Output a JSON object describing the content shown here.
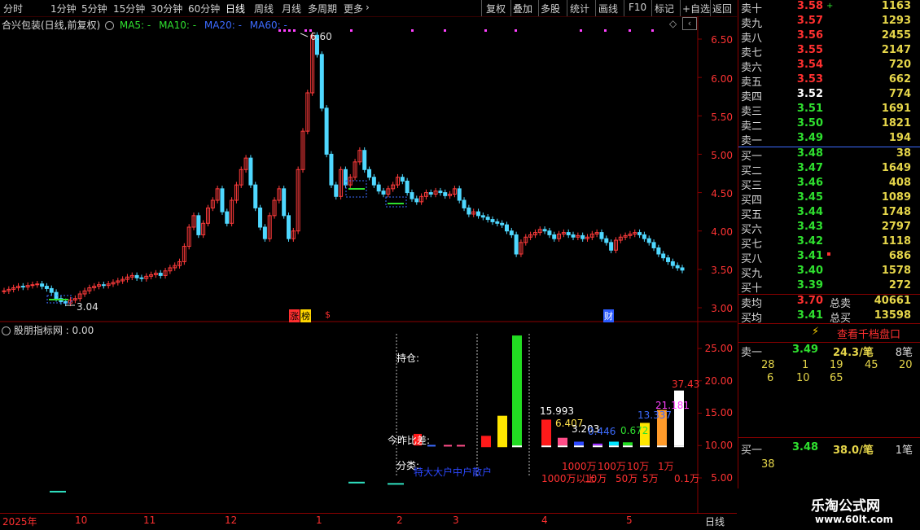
{
  "toolbar": {
    "tabs": [
      "分时",
      "1分钟",
      "5分钟",
      "15分钟",
      "30分钟",
      "60分钟",
      "日线",
      "周线",
      "月线",
      "多周期",
      "更多"
    ],
    "active_tab": "日线",
    "buttons": [
      "复权",
      "叠加",
      "多股",
      "统计",
      "画线",
      "F10",
      "标记",
      "+自选",
      "返回"
    ]
  },
  "chart": {
    "stock_title": "合兴包装(日线,前复权)",
    "ma_labels": [
      {
        "text": "MA5: -",
        "color": "#2fe02f"
      },
      {
        "text": "MA10: -",
        "color": "#2fe02f"
      },
      {
        "text": "MA20: -",
        "color": "#3c6bff"
      },
      {
        "text": "MA60: -",
        "color": "#3c6bff"
      }
    ],
    "high_label": "6.60",
    "low_label": "3.04",
    "y_axis": [
      "6.50",
      "6.00",
      "5.50",
      "5.00",
      "4.50",
      "4.00",
      "3.50",
      "3.00"
    ],
    "event_labels": [
      "涨",
      "榜",
      "$",
      "财"
    ]
  },
  "indicator": {
    "title": "股朋指标网 : 0.00",
    "y_axis": [
      "25.00",
      "20.00",
      "15.00",
      "10.00",
      "5.00"
    ],
    "label_hold": "持仓:",
    "label_diff": "今昨比差:",
    "label_class": "分类:",
    "class_text": "特大大户中户散户",
    "bar_values": [
      "15.993",
      "6.407",
      "3.203",
      "0.446",
      "0.672",
      "13.337",
      "21.181",
      "37.43"
    ],
    "tier_row1": [
      "1000万",
      "100万",
      "10万",
      "1万"
    ],
    "tier_row2": [
      "1000万以上",
      "10万",
      "50万",
      "5万",
      "0.1万"
    ]
  },
  "x_axis": [
    "2025年",
    "10",
    "11",
    "12",
    "1",
    "2",
    "3",
    "4",
    "5"
  ],
  "x_period": "日线",
  "order_book": {
    "asks": [
      {
        "label": "卖十",
        "price": "3.58",
        "vol": "1163",
        "color": "#ff3030"
      },
      {
        "label": "卖九",
        "price": "3.57",
        "vol": "1293",
        "color": "#ff3030"
      },
      {
        "label": "卖八",
        "price": "3.56",
        "vol": "2455",
        "color": "#ff3030"
      },
      {
        "label": "卖七",
        "price": "3.55",
        "vol": "2147",
        "color": "#ff3030"
      },
      {
        "label": "卖六",
        "price": "3.54",
        "vol": "720",
        "color": "#ff3030"
      },
      {
        "label": "卖五",
        "price": "3.53",
        "vol": "662",
        "color": "#ff3030"
      },
      {
        "label": "卖四",
        "price": "3.52",
        "vol": "774",
        "color": "#ffffff"
      },
      {
        "label": "卖三",
        "price": "3.51",
        "vol": "1691",
        "color": "#2fe02f"
      },
      {
        "label": "卖二",
        "price": "3.50",
        "vol": "1821",
        "color": "#2fe02f"
      },
      {
        "label": "卖一",
        "price": "3.49",
        "vol": "194",
        "color": "#2fe02f"
      }
    ],
    "bids": [
      {
        "label": "买一",
        "price": "3.48",
        "vol": "38",
        "color": "#2fe02f"
      },
      {
        "label": "买二",
        "price": "3.47",
        "vol": "1649",
        "color": "#2fe02f"
      },
      {
        "label": "买三",
        "price": "3.46",
        "vol": "408",
        "color": "#2fe02f"
      },
      {
        "label": "买四",
        "price": "3.45",
        "vol": "1089",
        "color": "#2fe02f"
      },
      {
        "label": "买五",
        "price": "3.44",
        "vol": "1748",
        "color": "#2fe02f"
      },
      {
        "label": "买六",
        "price": "3.43",
        "vol": "2797",
        "color": "#2fe02f"
      },
      {
        "label": "买七",
        "price": "3.42",
        "vol": "1118",
        "color": "#2fe02f"
      },
      {
        "label": "买八",
        "price": "3.41",
        "vol": "686",
        "color": "#2fe02f"
      },
      {
        "label": "买九",
        "price": "3.40",
        "vol": "1578",
        "color": "#2fe02f"
      },
      {
        "label": "买十",
        "price": "3.39",
        "vol": "272",
        "color": "#2fe02f"
      }
    ],
    "avg_sell": {
      "label": "卖均",
      "price": "3.70",
      "total_label": "总卖",
      "total": "40661"
    },
    "avg_buy": {
      "label": "买均",
      "price": "3.41",
      "total_label": "总买",
      "total": "13598"
    },
    "view_ten_button": "查看千档盘口",
    "sell1_detail": {
      "label": "卖一",
      "price": "3.49",
      "per": "24.3/笔",
      "count": "8笔",
      "row1": [
        "28",
        "1",
        "19",
        "45",
        "20"
      ],
      "row2": [
        "6",
        "10",
        "65"
      ]
    },
    "buy1_detail": {
      "label": "买一",
      "price": "3.48",
      "per": "38.0/笔",
      "count": "1笔",
      "row1": [
        "38"
      ]
    }
  },
  "watermark": {
    "name": "乐淘公式网",
    "url": "www.60lt.com"
  }
}
